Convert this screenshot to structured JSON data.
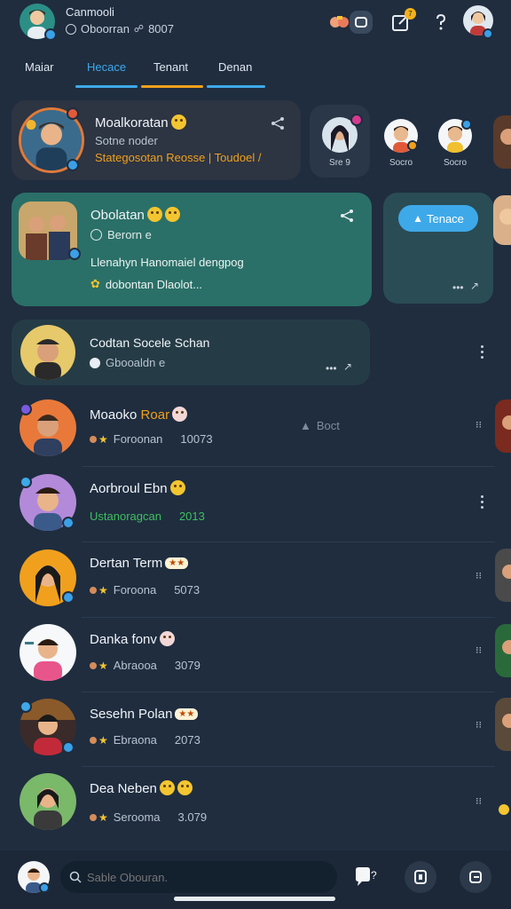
{
  "header": {
    "name": "Canmooli",
    "status": "Oboorran",
    "code": "8007"
  },
  "tabs": [
    {
      "label": "Maiar",
      "color": "#e8edf3"
    },
    {
      "label": "Hecace",
      "color": "#3ea9e9"
    },
    {
      "label": "Tenant",
      "color": "#f0a01c"
    },
    {
      "label": "Denan",
      "color": "#3ea9e9"
    }
  ],
  "featured": {
    "name": "Moalkoratan",
    "sub": "Sotne noder",
    "line": "Stategosotan Reosse | Toudoel /"
  },
  "stories": [
    {
      "label": "Sre 9"
    },
    {
      "label": "Socro"
    },
    {
      "label": "Socro"
    }
  ],
  "active": {
    "name": "Obolatan",
    "status": "Berorn e",
    "message": "Llenahyn Hanomaiel dengpog",
    "attachment": "dobontan Dlaolot..."
  },
  "side_card": {
    "button": "Tenace"
  },
  "conv3": {
    "name": "Codtan Socele Schan",
    "status": "Gbooaldn e"
  },
  "floating_label": "Boct",
  "chats": [
    {
      "name": "Moaoko",
      "highlight": "Roar",
      "meta": "Foroonan",
      "count": "10073",
      "count_color": "#b8c3cf"
    },
    {
      "name": "Aorbroul Ebn",
      "highlight": "",
      "meta": "Ustanoragcan",
      "count": "2013",
      "count_color": "#3fbf5f"
    },
    {
      "name": "Dertan Term",
      "highlight": "",
      "meta": "Foroona",
      "count": "5073",
      "count_color": "#b8c3cf"
    },
    {
      "name": "Danka fonv",
      "highlight": "",
      "meta": "Abraooa",
      "count": "3079",
      "count_color": "#b8c3cf"
    },
    {
      "name": "Sesehn Polan",
      "highlight": "",
      "meta": "Ebraona",
      "count": "2073",
      "count_color": "#b8c3cf"
    },
    {
      "name": "Dea Neben",
      "highlight": "",
      "meta": "Serooma",
      "count": "3.079",
      "count_color": "#b8c3cf"
    }
  ],
  "bottom": {
    "search_placeholder": "Sable Obouran."
  },
  "colors": {
    "background": "#1f2d3f",
    "active_card": "#2a7068",
    "card": "#2a3748",
    "accent_blue": "#3ea9e9",
    "accent_orange": "#f0a01c"
  }
}
